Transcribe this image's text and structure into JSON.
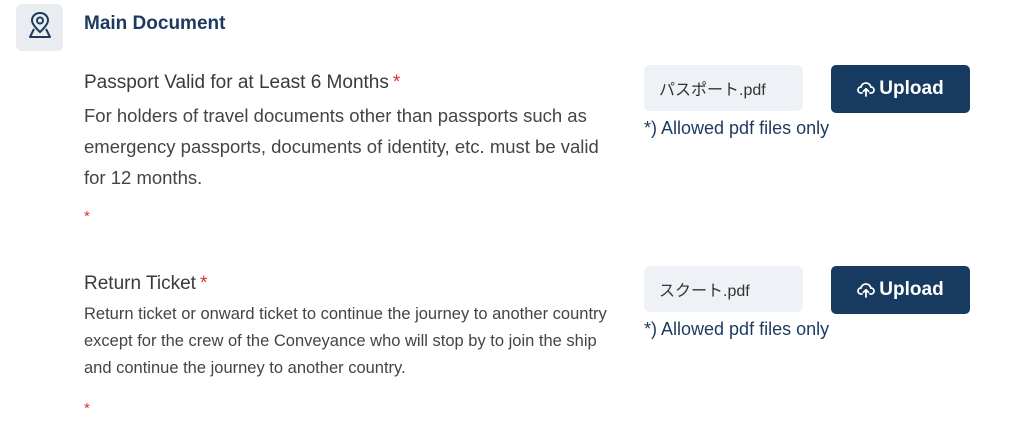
{
  "section": {
    "icon": "map-pin-icon",
    "title": "Main Document"
  },
  "documents": [
    {
      "title": "Passport Valid for at Least 6 Months",
      "required_mark": "*",
      "description": "For holders of travel documents other than passports such as emergency passports, documents of identity, etc. must be valid for 12 months.",
      "extra_required_mark": "*",
      "file_name": "パスポート.pdf",
      "upload_label": "Upload",
      "upload_icon": "cloud-upload-icon",
      "allowed_note": "*) Allowed pdf files only"
    },
    {
      "title": "Return Ticket",
      "required_mark": "*",
      "description": "Return ticket or onward ticket to continue the journey to another country except for the crew of the Conveyance who will stop by to join the ship and continue the journey to another country.",
      "extra_required_mark": "*",
      "file_name": "スクート.pdf",
      "upload_label": "Upload",
      "upload_icon": "cloud-upload-icon",
      "allowed_note": "*) Allowed pdf files only"
    }
  ],
  "colors": {
    "primary": "#173a60",
    "title": "#1c3a5e",
    "required": "#e03131",
    "file_box_bg": "#eef1f5",
    "icon_box_bg": "#e9ecf1"
  }
}
